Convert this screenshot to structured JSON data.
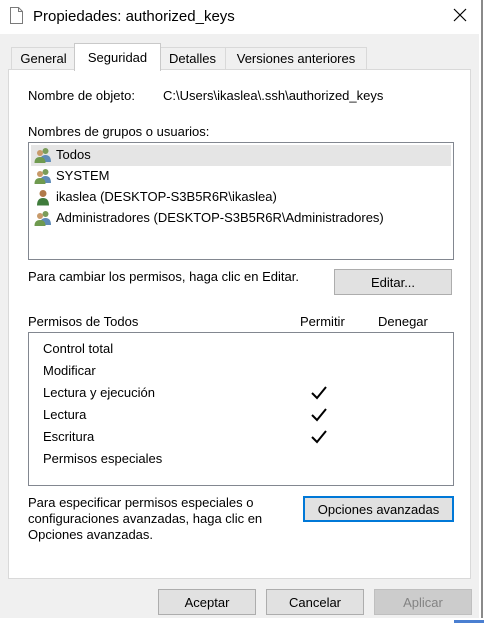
{
  "window": {
    "title": "Propiedades: authorized_keys",
    "icon": "document-icon",
    "close_icon": "close-icon"
  },
  "tabs": [
    {
      "label": "General",
      "active": false
    },
    {
      "label": "Seguridad",
      "active": true
    },
    {
      "label": "Detalles",
      "active": false
    },
    {
      "label": "Versiones anteriores",
      "active": false
    }
  ],
  "security": {
    "object_name_label": "Nombre de objeto:",
    "object_name_value": "C:\\Users\\ikaslea\\.ssh\\authorized_keys",
    "groups_label": "Nombres de grupos o usuarios:",
    "users": [
      {
        "name": "Todos",
        "icon": "group-icon",
        "selected": true
      },
      {
        "name": "SYSTEM",
        "icon": "group-icon",
        "selected": false
      },
      {
        "name": "ikaslea (DESKTOP-S3B5R6R\\ikaslea)",
        "icon": "user-icon",
        "selected": false
      },
      {
        "name": "Administradores (DESKTOP-S3B5R6R\\Administradores)",
        "icon": "group-icon",
        "selected": false
      }
    ],
    "edit_hint": "Para cambiar los permisos, haga clic en Editar.",
    "edit_button": "Editar...",
    "permissions_label": "Permisos de Todos",
    "allow_header": "Permitir",
    "deny_header": "Denegar",
    "permissions": [
      {
        "name": "Control total",
        "allow": false,
        "deny": false
      },
      {
        "name": "Modificar",
        "allow": false,
        "deny": false
      },
      {
        "name": "Lectura y ejecución",
        "allow": true,
        "deny": false
      },
      {
        "name": "Lectura",
        "allow": true,
        "deny": false
      },
      {
        "name": "Escritura",
        "allow": true,
        "deny": false
      },
      {
        "name": "Permisos especiales",
        "allow": false,
        "deny": false
      }
    ],
    "advanced_hint_line1": "Para especificar permisos especiales o",
    "advanced_hint_line2": "configuraciones avanzadas, haga clic en",
    "advanced_hint_line3": "Opciones avanzadas.",
    "advanced_button": "Opciones avanzadas"
  },
  "footer": {
    "accept": "Aceptar",
    "cancel": "Cancelar",
    "apply": "Aplicar"
  },
  "colors": {
    "focus_border": "#0078d7",
    "selection": "#e5e5e5",
    "window_bg": "#f0f0f0"
  }
}
